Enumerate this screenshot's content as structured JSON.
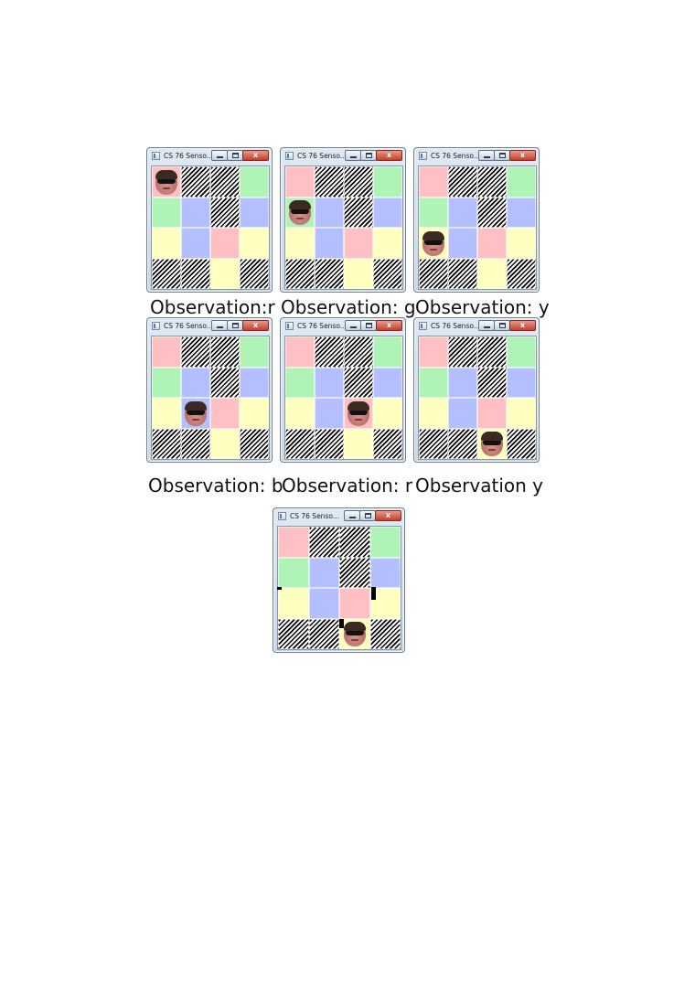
{
  "window_title": "CS 76 Senso...",
  "buttons": {
    "close": "x"
  },
  "palette": {
    "r": "#ffc0c4",
    "g": "#b0f3b6",
    "b": "#b3bfff",
    "y": "#ffffc0",
    "wall": "black-white-diagonal-stripes"
  },
  "maze": [
    [
      "r",
      "w",
      "w",
      "g"
    ],
    [
      "g",
      "b",
      "w",
      "b"
    ],
    [
      "y",
      "b",
      "r",
      "y"
    ],
    [
      "w",
      "w",
      "y",
      "w"
    ]
  ],
  "robot_icon": "robot-face-with-sunglasses",
  "frames": [
    {
      "robot": [
        0,
        0
      ],
      "caption": "Observation:r"
    },
    {
      "robot": [
        1,
        0
      ],
      "caption": "Observation: g"
    },
    {
      "robot": [
        2,
        0
      ],
      "caption": "Observation: y"
    },
    {
      "robot": [
        2,
        1
      ],
      "caption": "Observation: b"
    },
    {
      "robot": [
        2,
        2
      ],
      "caption": "Observation: r"
    },
    {
      "robot": [
        3,
        2
      ],
      "caption": "Observation y"
    },
    {
      "robot": [
        3,
        2
      ],
      "caption": ""
    }
  ]
}
